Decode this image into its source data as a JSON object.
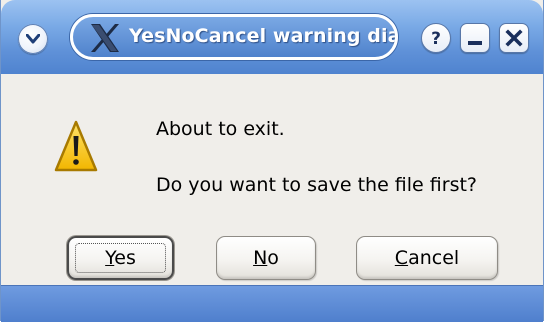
{
  "window": {
    "title": "YesNoCancel warning dia",
    "buttons": {
      "menu": "menu-icon",
      "help": "?",
      "minimize": "minimize-icon",
      "close": "close-icon"
    }
  },
  "dialog": {
    "icon": "warning-icon",
    "message_line1": "About to exit.",
    "message_line2": "Do you want to save the file first?"
  },
  "buttons": {
    "yes": {
      "mnemonic": "Y",
      "rest": "es"
    },
    "no": {
      "mnemonic": "N",
      "rest": "o"
    },
    "cancel": {
      "mnemonic": "C",
      "rest": "ancel"
    }
  },
  "colors": {
    "titlebar": "#5f91d8",
    "dialog_bg": "#f0eeea",
    "warning_yellow": "#f5c400"
  }
}
